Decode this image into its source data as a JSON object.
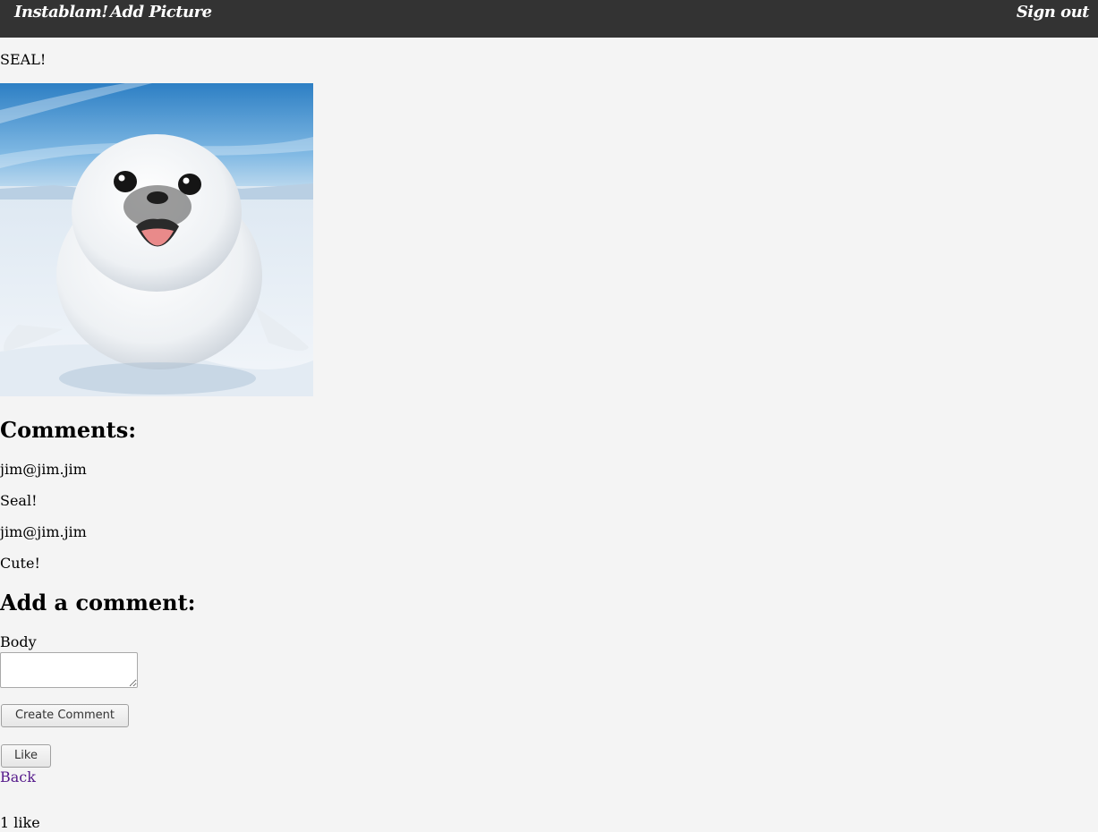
{
  "nav": {
    "brand": "Instablam!",
    "add_picture": "Add Picture",
    "sign_out": "Sign out",
    "bg_color": "#333333"
  },
  "picture": {
    "title": "SEAL!",
    "image": "harp-seal-pup-on-ice"
  },
  "comments": {
    "heading": "Comments:",
    "items": [
      {
        "author": "jim@jim.jim",
        "body": "Seal!"
      },
      {
        "author": "jim@jim.jim",
        "body": "Cute!"
      }
    ]
  },
  "comment_form": {
    "heading": "Add a comment:",
    "body_label": "Body",
    "body_value": "",
    "submit_label": "Create Comment"
  },
  "like_button": "Like",
  "back_link": "Back",
  "likes_text": "1 like"
}
